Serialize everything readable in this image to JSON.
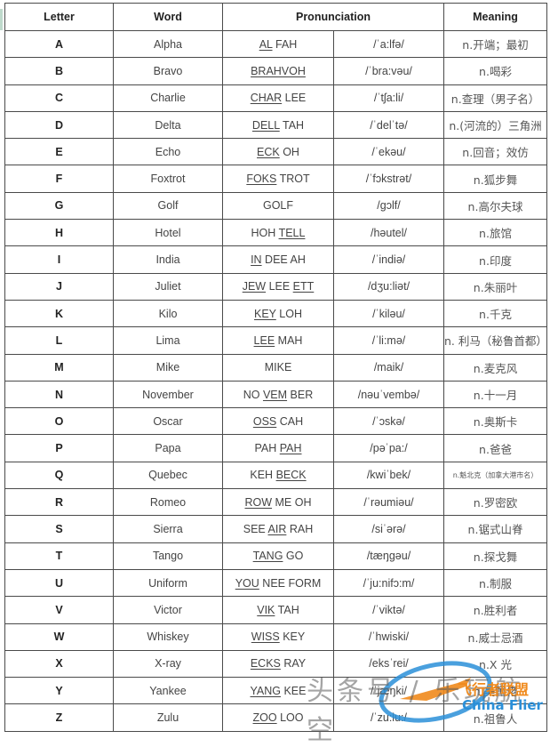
{
  "headers": {
    "letter": "Letter",
    "word": "Word",
    "pronunciation": "Pronunciation",
    "meaning": "Meaning"
  },
  "rows": [
    {
      "letter": "A",
      "word": "Alpha",
      "pron_stressed": "AL",
      "pron_rest": " FAH",
      "pron_stress_pos": "start",
      "ipa": "/ˈa:lfə/",
      "meaning": "n.开端；最初"
    },
    {
      "letter": "B",
      "word": "Bravo",
      "pron_stressed": "BRAHVOH",
      "pron_rest": "",
      "pron_stress_pos": "start",
      "ipa": "/ˈbra:vəu/",
      "meaning": "n.喝彩"
    },
    {
      "letter": "C",
      "word": "Charlie",
      "pron_stressed": "CHAR",
      "pron_rest": " LEE",
      "pron_stress_pos": "start",
      "ipa": "/ˈtʃa:li/",
      "meaning": "n.查理（男子名）"
    },
    {
      "letter": "D",
      "word": "Delta",
      "pron_stressed": "DELL",
      "pron_rest": " TAH",
      "pron_stress_pos": "start",
      "ipa": "/ˈdelˈtə/",
      "meaning": "n.(河流的）三角洲"
    },
    {
      "letter": "E",
      "word": "Echo",
      "pron_stressed": "ECK",
      "pron_rest": " OH",
      "pron_stress_pos": "start",
      "ipa": "/ˈekəu/",
      "meaning": "n.回音；效仿"
    },
    {
      "letter": "F",
      "word": "Foxtrot",
      "pron_stressed": "FOKS",
      "pron_rest": " TROT",
      "pron_stress_pos": "start",
      "ipa": "/ˈfɔkstrət/",
      "meaning": "n.狐步舞"
    },
    {
      "letter": "G",
      "word": "Golf",
      "pron_stressed": "",
      "pron_rest": "GOLF",
      "pron_stress_pos": "start",
      "ipa": "/gɔlf/",
      "meaning": "n.高尔夫球"
    },
    {
      "letter": "H",
      "word": "Hotel",
      "pron_stressed": "TELL",
      "pron_rest": "HOH ",
      "pron_stress_pos": "end",
      "ipa": "/həutel/",
      "meaning": "n.旅馆"
    },
    {
      "letter": "I",
      "word": "India",
      "pron_stressed": "IN",
      "pron_rest": " DEE AH",
      "pron_stress_pos": "start",
      "ipa": "/ˈindiə/",
      "meaning": "n.印度"
    },
    {
      "letter": "J",
      "word": "Juliet",
      "pron_stressed": "JEW",
      "pron_rest": " LEE ",
      "pron_stressed2": "ETT",
      "pron_stress_pos": "both",
      "ipa": "/dʒu:liət/",
      "meaning": "n.朱丽叶"
    },
    {
      "letter": "K",
      "word": "Kilo",
      "pron_stressed": "KEY",
      "pron_rest": " LOH",
      "pron_stress_pos": "start",
      "ipa": "/ˈkiləu/",
      "meaning": "n.千克"
    },
    {
      "letter": "L",
      "word": "Lima",
      "pron_stressed": "LEE",
      "pron_rest": " MAH",
      "pron_stress_pos": "start",
      "ipa": "/ˈli:mə/",
      "meaning": "n. 利马（秘鲁首都）"
    },
    {
      "letter": "M",
      "word": "Mike",
      "pron_stressed": "",
      "pron_rest": "MIKE",
      "pron_stress_pos": "start",
      "ipa": "/maik/",
      "meaning": "n.麦克风"
    },
    {
      "letter": "N",
      "word": "November",
      "pron_pre": "NO ",
      "pron_stressed": "VEM",
      "pron_rest": " BER",
      "pron_stress_pos": "middle",
      "ipa": "/nəuˈvembə/",
      "meaning": "n.十一月"
    },
    {
      "letter": "O",
      "word": "Oscar",
      "pron_stressed": "OSS",
      "pron_rest": " CAH",
      "pron_stress_pos": "start",
      "ipa": "/ˈɔskə/",
      "meaning": "n.奥斯卡"
    },
    {
      "letter": "P",
      "word": "Papa",
      "pron_stressed": "PAH",
      "pron_rest": "PAH ",
      "pron_stress_pos": "end",
      "ipa": "/pəˈpa:/",
      "meaning": "n.爸爸"
    },
    {
      "letter": "Q",
      "word": "Quebec",
      "pron_stressed": "BECK",
      "pron_rest": "KEH ",
      "pron_stress_pos": "end",
      "ipa": "/kwiˈbek/",
      "meaning": "n.魁北克（加拿大港市名）",
      "meaning_small": true
    },
    {
      "letter": "R",
      "word": "Romeo",
      "pron_stressed": "ROW",
      "pron_rest": " ME OH",
      "pron_stress_pos": "start",
      "ipa": "/ˈrəumiəu/",
      "meaning": "n.罗密欧"
    },
    {
      "letter": "S",
      "word": "Sierra",
      "pron_pre": "SEE ",
      "pron_stressed": "AIR",
      "pron_rest": " RAH",
      "pron_stress_pos": "middle",
      "ipa": "/siˈərə/",
      "meaning": "n.锯式山脊"
    },
    {
      "letter": "T",
      "word": "Tango",
      "pron_stressed": "TANG",
      "pron_rest": " GO",
      "pron_stress_pos": "start",
      "ipa": "/tæŋgəu/",
      "meaning": "n.探戈舞"
    },
    {
      "letter": "U",
      "word": "Uniform",
      "pron_stressed": "YOU",
      "pron_rest": " NEE FORM",
      "pron_stress_pos": "start",
      "ipa": "/ˈju:nifɔ:m/",
      "meaning": "n.制服"
    },
    {
      "letter": "V",
      "word": "Victor",
      "pron_stressed": "VIK",
      "pron_rest": " TAH",
      "pron_stress_pos": "start",
      "ipa": "/ˈviktə/",
      "meaning": "n.胜利者"
    },
    {
      "letter": "W",
      "word": "Whiskey",
      "pron_stressed": "WISS",
      "pron_rest": " KEY",
      "pron_stress_pos": "start",
      "ipa": "/ˈhwiski/",
      "meaning": "n.威士忌酒"
    },
    {
      "letter": "X",
      "word": "X-ray",
      "pron_stressed": "ECKS",
      "pron_rest": " RAY",
      "pron_stress_pos": "start",
      "ipa": "/eksˈrei/",
      "meaning": "n.X 光"
    },
    {
      "letter": "Y",
      "word": "Yankee",
      "pron_stressed": "YANG",
      "pron_rest": " KEE",
      "pron_stress_pos": "start",
      "ipa": "/ˈjæŋki/",
      "meaning": "n.美国佬"
    },
    {
      "letter": "Z",
      "word": "Zulu",
      "pron_stressed": "ZOO",
      "pron_rest": " LOO",
      "pron_stress_pos": "start",
      "ipa": "/ˈzu:lu:/",
      "meaning": "n.祖鲁人"
    }
  ],
  "watermark": {
    "text": "头条号 / 乐玩航空",
    "logo_cn": "飞行者联盟",
    "logo_en": "China Flier",
    "logo_colors": {
      "orange": "#f08a1c",
      "blue": "#2a8fd8"
    }
  }
}
